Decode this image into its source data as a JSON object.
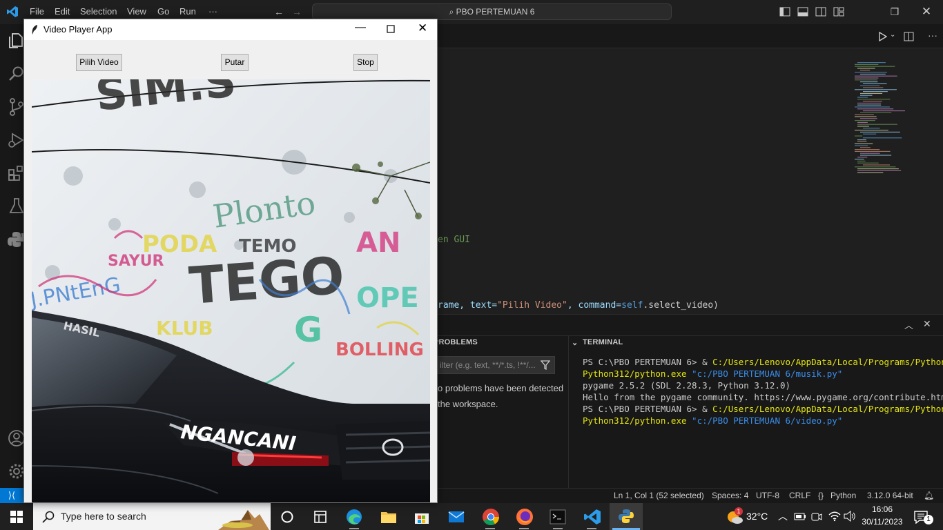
{
  "titlebar": {
    "menus": [
      "File",
      "Edit",
      "Selection",
      "View",
      "Go",
      "Run",
      "···"
    ],
    "search": "PBO PERTEMUAN 6"
  },
  "editor": {
    "comment_line": "en GUI",
    "code_prefix": "rame, text=",
    "code_string": "\"Pilih Video\"",
    "code_mid": ", command=",
    "code_self": "self",
    "code_end": ".select_video)"
  },
  "panel": {
    "problems_title": "PROBLEMS",
    "filter_placeholder": "ilter (e.g. text, **/*.ts, !**/...",
    "problems_line1": "o problems have been detected",
    "problems_line2": "the workspace.",
    "terminal_title": "TERMINAL"
  },
  "terminal": {
    "l1_prompt": "PS C:\\PBO PERTEMUAN 6> & ",
    "l1_exe": "C:/Users/Lenovo/AppData/Local/Programs/Python/",
    "l2_exe": "Python312/python.exe",
    "l2_arg": " \"c:/PBO PERTEMUAN 6/musik.py\"",
    "l3": "pygame 2.5.2 (SDL 2.28.3, Python 3.12.0)",
    "l4": "Hello from the pygame community. https://www.pygame.org/contribute.html",
    "l5_prompt": "PS C:\\PBO PERTEMUAN 6> & ",
    "l5_exe": "C:/Users/Lenovo/AppData/Local/Programs/Python/",
    "l6_exe": "Python312/python.exe",
    "l6_arg": " \"c:/PBO PERTEMUAN 6/video.py\""
  },
  "statusbar": {
    "position": "Ln 1, Col 1 (52 selected)",
    "spaces": "Spaces: 4",
    "encoding": "UTF-8",
    "eol": "CRLF",
    "language": "Python",
    "interpreter": "3.12.0 64-bit"
  },
  "taskbar": {
    "search_placeholder": "Type here to search",
    "weather": "32°C",
    "weather_badge": "1",
    "time": "16:06",
    "date": "30/11/2023",
    "notif_count": "1"
  },
  "video_player": {
    "title": "Video Player App",
    "buttons": {
      "select": "Pilih Video",
      "play": "Putar",
      "stop": "Stop"
    },
    "frame_text": {
      "top": "SIM.S",
      "plonto": "Plonto",
      "tego": "TEGO",
      "left": "J.PNtEnG",
      "car_plate": "NGANCANI",
      "windshield": "HASIL"
    }
  },
  "colors": {
    "vscode_bg": "#1f1f1f",
    "accent": "#0078d4",
    "terminal_yellow": "#e5e510",
    "terminal_blue": "#3b8eea"
  }
}
